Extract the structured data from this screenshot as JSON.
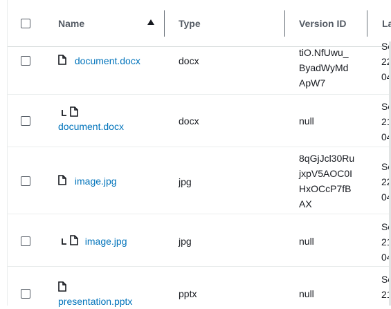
{
  "header": {
    "name_label": "Name",
    "type_label": "Type",
    "version_label": "Version ID",
    "last_label": "La"
  },
  "rows": [
    {
      "name": "document.docx",
      "indent": false,
      "type": "docx",
      "version": [
        "tiO.NfUwu_",
        "ByadWyMd",
        "ApW7"
      ],
      "last": [
        "Se",
        "22",
        "04"
      ]
    },
    {
      "name": "document.docx",
      "indent": true,
      "type": "docx",
      "version": [
        "null"
      ],
      "last": [
        "Se",
        "21",
        "04"
      ]
    },
    {
      "name": "image.jpg",
      "indent": false,
      "type": "jpg",
      "version": [
        "8qGjJcl30Ru",
        "jxpV5AOC0I",
        "HxOCcP7fB",
        "AX"
      ],
      "last": [
        "Se",
        "22",
        "04"
      ]
    },
    {
      "name": "image.jpg",
      "indent": true,
      "type": "jpg",
      "version": [
        "null"
      ],
      "last": [
        "Se",
        "21",
        "04"
      ]
    },
    {
      "name": "presentation.pptx",
      "indent": false,
      "type": "pptx",
      "version": [
        "null"
      ],
      "last": [
        "Se",
        "21"
      ]
    }
  ]
}
